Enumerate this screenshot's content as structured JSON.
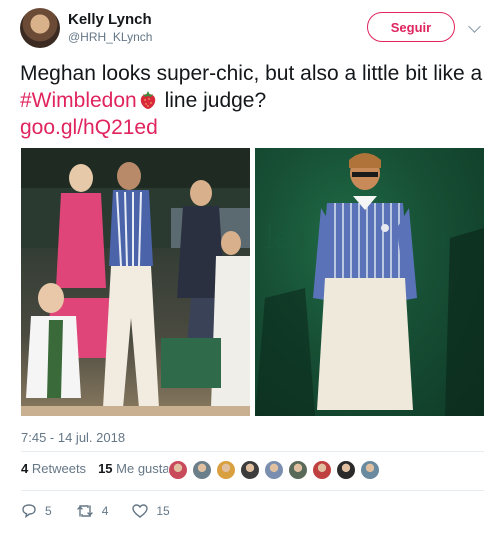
{
  "author": {
    "name": "Kelly Lynch",
    "handle": "@HRH_KLynch"
  },
  "follow_label": "Seguir",
  "tweet": {
    "text_1": "Meghan looks super-chic, but also a little bit like a ",
    "hashtag": "#Wimbledon",
    "text_2": " line judge?",
    "link": "goo.gl/hQ21ed"
  },
  "media": {
    "photo_left_alt": "",
    "photo_right_alt": ""
  },
  "timestamp": "7:45 - 14 jul. 2018",
  "stats": {
    "retweets_count": "4",
    "retweets_label": "Retweets",
    "likes_count": "15",
    "likes_label": "Me gusta"
  },
  "likers_colors": [
    "#c94a5a",
    "#6b7f8a",
    "#d9a040",
    "#3c3c3c",
    "#7a8fb0",
    "#5a6a5a",
    "#c04040",
    "#2a2a2a",
    "#6a8aa0"
  ],
  "actions": {
    "replies": "5",
    "retweets": "4",
    "likes": "15"
  },
  "colors": {
    "accent": "#e0245e",
    "secondary_text": "#657786"
  }
}
